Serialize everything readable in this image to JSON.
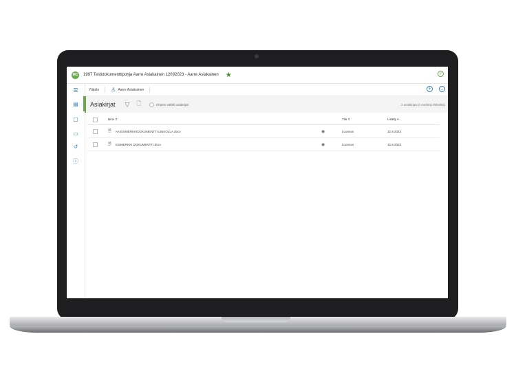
{
  "app": {
    "avatar_initials": "MC",
    "document_title": "1997 Testidokumenttipohja Aarre Asiakainen 12092023 - Aarre Asiakainen",
    "accent_color": "#6aa84f",
    "link_color": "#2b7bb9"
  },
  "breadcrumb": {
    "root": "Yläpito",
    "user": "Aarre Asiakainen"
  },
  "section": {
    "title": "Asiakirjat",
    "only_mine_label": "Ohjeen valikki asiakirjat",
    "count_text": "2 asiakirjaa (0 merkitty lähteiksi)"
  },
  "table": {
    "headers": {
      "name": "Nimi ⇕",
      "status": "Tila ⇕",
      "created": "Lisätty ▾"
    },
    "rows": [
      {
        "name": "AA ESIMERKKIDOKUMENTTI LINKOLLA.docx",
        "status": "Luonnos",
        "created": "12.9.2023"
      },
      {
        "name": "ESIMERKKI DOKUMENTTI.docx",
        "status": "Luonnos",
        "created": "12.9.2023"
      }
    ]
  }
}
